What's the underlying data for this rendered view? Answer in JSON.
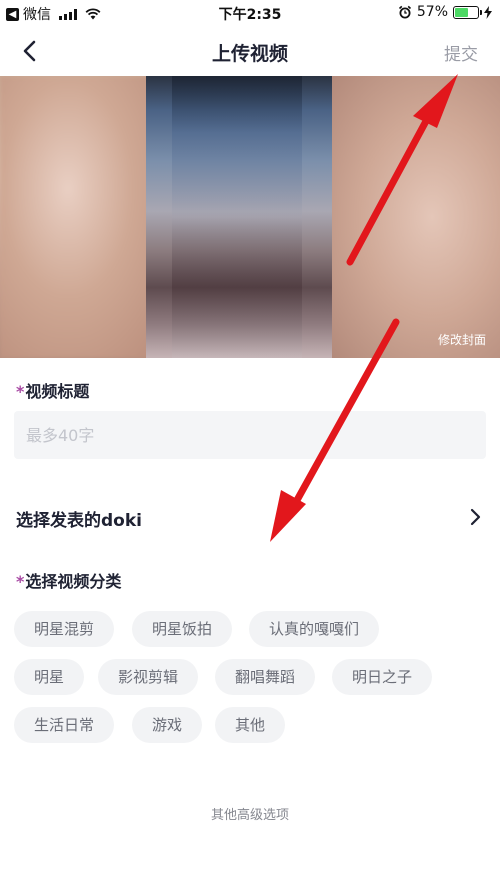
{
  "status_bar": {
    "app_back": "微信",
    "time": "下午2:35",
    "battery_percent": "57%",
    "battery_level": 0.57
  },
  "nav": {
    "title": "上传视频",
    "submit": "提交"
  },
  "cover": {
    "edit_label": "修改封面"
  },
  "form": {
    "required_mark": "*",
    "title_label": "视频标题",
    "title_placeholder": "最多40字",
    "title_value": "",
    "doki_label": "选择发表的doki",
    "category_label": "选择视频分类",
    "categories": [
      "明星混剪",
      "明星饭拍",
      "认真的嘎嘎们",
      "明星",
      "影视剪辑",
      "翻唱舞蹈",
      "明日之子",
      "生活日常",
      "游戏",
      "其他"
    ]
  },
  "footer": {
    "advanced": "其他高级选项"
  },
  "colors": {
    "accent_required": "#a84aa4",
    "annotation_arrow": "#e2171c",
    "chip_bg": "#f2f3f5"
  }
}
